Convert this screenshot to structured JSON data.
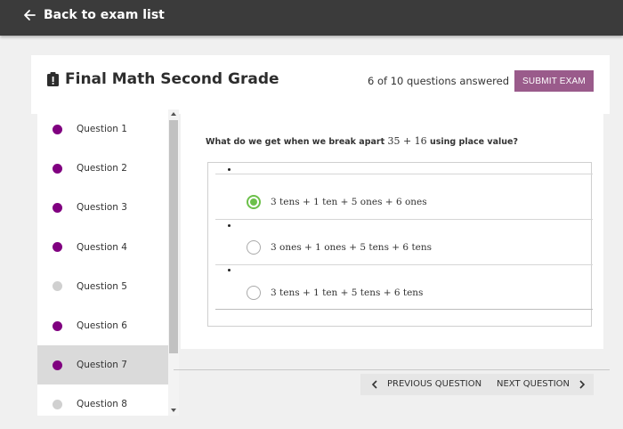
{
  "topbar": {
    "back_label": "Back to exam list"
  },
  "exam": {
    "title": "Final Math Second Grade",
    "progress_text": "6 of 10 questions answered",
    "submit_label": "SUBMIT EXAM"
  },
  "colors": {
    "answered": "#800080",
    "unanswered": "#d0d0d0",
    "selected_radio": "#6cc04a",
    "submit": "#9a5b8b"
  },
  "sidebar": {
    "items": [
      {
        "label": "Question 1",
        "answered": true,
        "active": false
      },
      {
        "label": "Question 2",
        "answered": true,
        "active": false
      },
      {
        "label": "Question 3",
        "answered": true,
        "active": false
      },
      {
        "label": "Question 4",
        "answered": true,
        "active": false
      },
      {
        "label": "Question 5",
        "answered": false,
        "active": false
      },
      {
        "label": "Question 6",
        "answered": true,
        "active": false
      },
      {
        "label": "Question 7",
        "answered": true,
        "active": true
      },
      {
        "label": "Question 8",
        "answered": false,
        "active": false
      }
    ]
  },
  "question": {
    "prompt_prefix": "What do we get when we break apart",
    "prompt_math": "35 + 16",
    "prompt_suffix": "using place value?",
    "options": [
      {
        "text": "3 tens + 1 ten + 5 ones + 6 ones",
        "selected": true
      },
      {
        "text": "3 ones + 1 ones + 5 tens + 6 tens",
        "selected": false
      },
      {
        "text": "3 tens + 1 ten + 5 tens + 6 tens",
        "selected": false
      }
    ]
  },
  "navigation": {
    "prev_label": "PREVIOUS QUESTION",
    "next_label": "NEXT QUESTION"
  }
}
